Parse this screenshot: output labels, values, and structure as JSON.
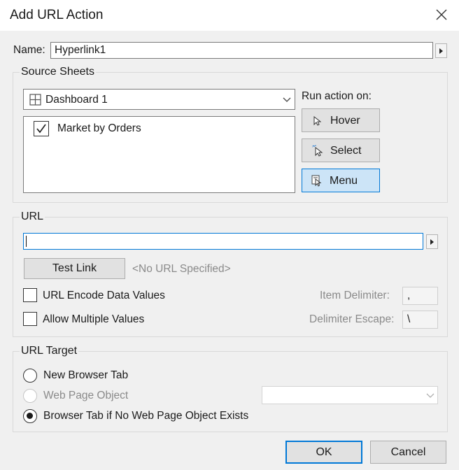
{
  "dialog": {
    "title": "Add URL Action"
  },
  "name": {
    "label": "Name:",
    "value": "Hyperlink1"
  },
  "source_sheets": {
    "label": "Source Sheets",
    "dashboard": "Dashboard 1",
    "sheets": [
      {
        "label": "Market by Orders",
        "checked": true
      }
    ],
    "run_action_label": "Run action on:",
    "buttons": {
      "hover": "Hover",
      "select": "Select",
      "menu": "Menu"
    },
    "selected": "Menu"
  },
  "url": {
    "label": "URL",
    "value": "",
    "test_link": "Test Link",
    "status": "<No URL Specified>",
    "encode_label": "URL Encode Data Values",
    "multiple_label": "Allow Multiple Values",
    "item_delimiter_label": "Item Delimiter:",
    "item_delimiter_value": ",",
    "delimiter_escape_label": "Delimiter Escape:",
    "delimiter_escape_value": "\\"
  },
  "url_target": {
    "label": "URL Target",
    "options": {
      "new_tab": "New Browser Tab",
      "web_page_object": "Web Page Object",
      "browser_tab_if_none": "Browser Tab if No Web Page Object Exists"
    },
    "selected": "browser_tab_if_none"
  },
  "footer": {
    "ok": "OK",
    "cancel": "Cancel"
  },
  "colors": {
    "accent": "#0078d7",
    "menu_bg": "#cce4f7",
    "button_bg": "#e1e1e1"
  }
}
